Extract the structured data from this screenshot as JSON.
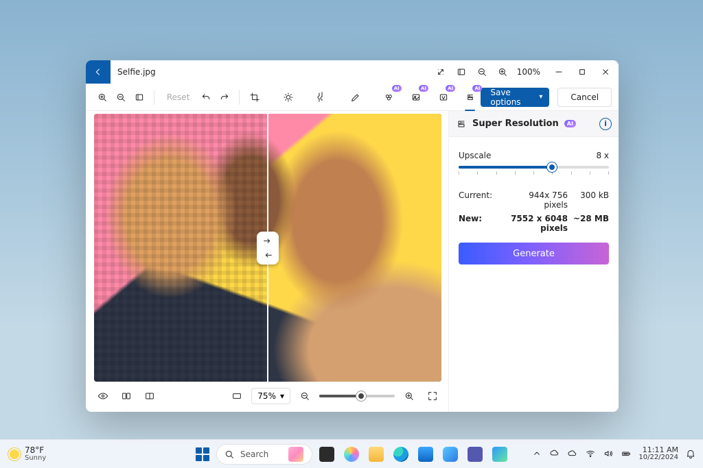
{
  "titlebar": {
    "filename": "Selfie.jpg",
    "zoom_pct": "100%"
  },
  "toolbar": {
    "reset": "Reset",
    "ai_badge": "AI",
    "save_options": "Save options",
    "cancel": "Cancel"
  },
  "panel": {
    "title": "Super Resolution",
    "ai_badge": "AI",
    "upscale_label": "Upscale",
    "upscale_value": "8 x",
    "dims": {
      "current_label": "Current:",
      "current_px": "944x 756 pixels",
      "current_size": "300 kB",
      "new_label": "New:",
      "new_px": "7552 x 6048 pixels",
      "new_size": "~28 MB"
    },
    "generate": "Generate"
  },
  "bottombar": {
    "zoom_dropdown": "75%"
  },
  "taskbar": {
    "weather": {
      "temp": "78°F",
      "desc": "Sunny"
    },
    "search_placeholder": "Search",
    "clock": {
      "time": "11:11 AM",
      "date": "10/22/2024"
    }
  }
}
